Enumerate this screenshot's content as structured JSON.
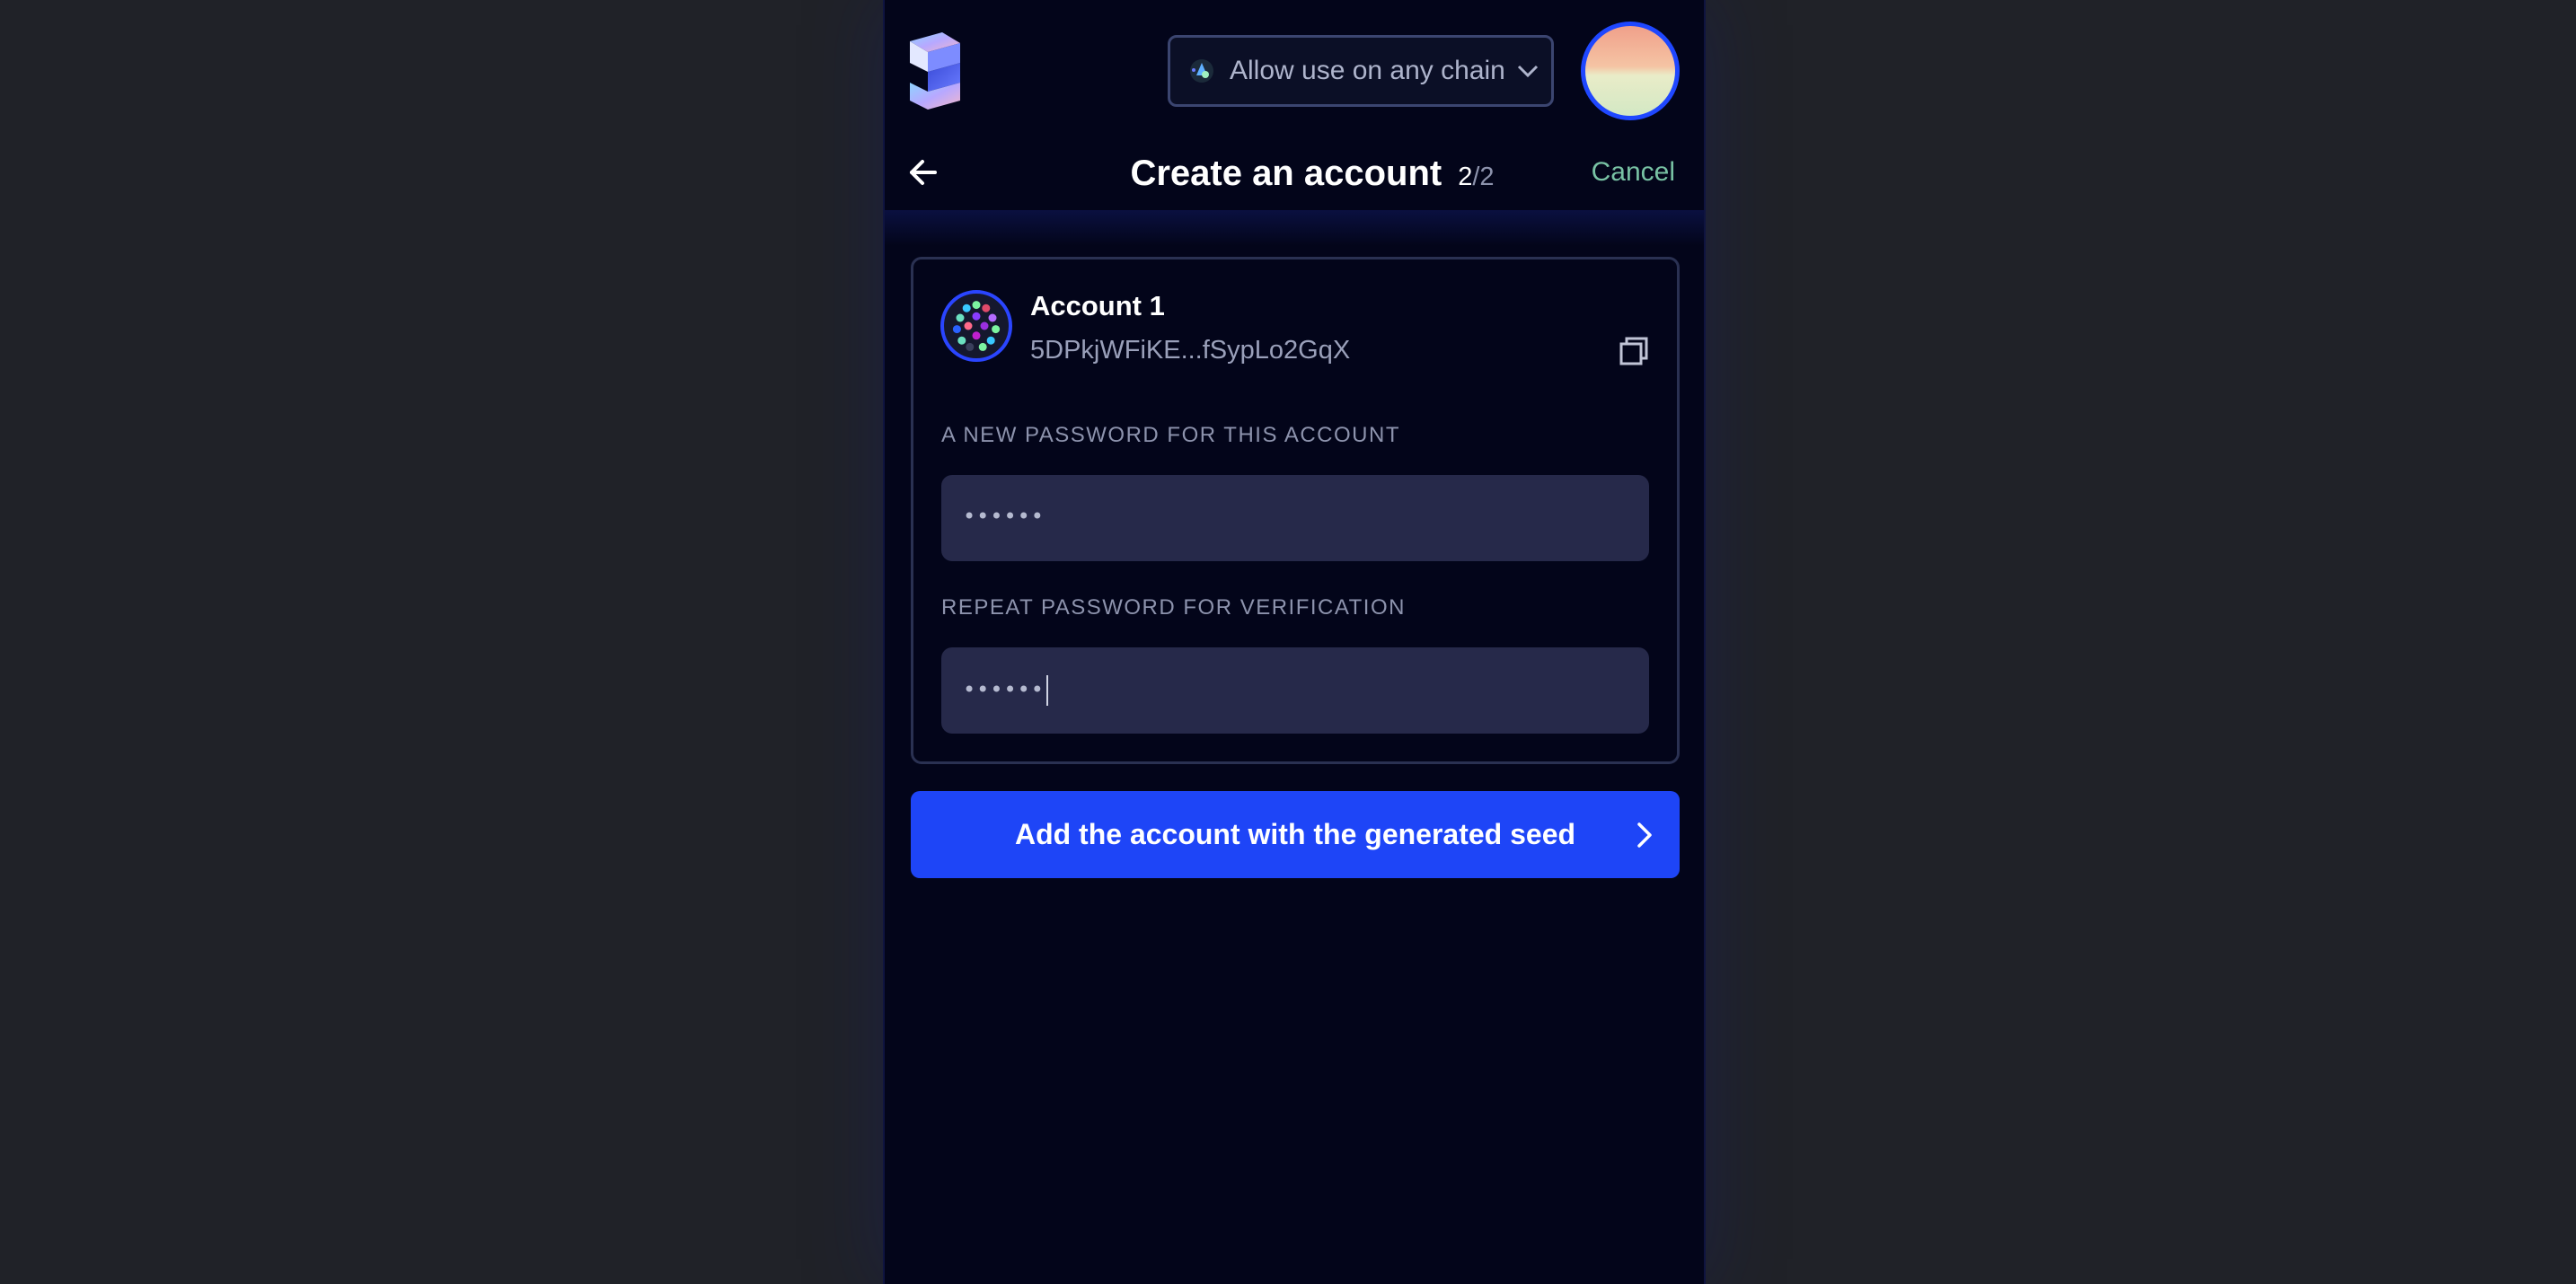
{
  "header": {
    "chain_select": {
      "label": "Allow use on any chain",
      "icon": "chain-icon"
    },
    "title": "Create an account",
    "step_current": "2",
    "step_total": "/2",
    "cancel_label": "Cancel"
  },
  "account": {
    "name": "Account 1",
    "address": "5DPkjWFiKE...fSypLo2GqX"
  },
  "form": {
    "new_password_label": "A NEW PASSWORD FOR THIS ACCOUNT",
    "new_password_value": "••••••",
    "repeat_password_label": "REPEAT PASSWORD FOR VERIFICATION",
    "repeat_password_value": "••••••"
  },
  "submit_label": "Add the account with the generated seed",
  "colors": {
    "page_bg": "#202228",
    "panel_bg": "#03051a",
    "accent": "#1e45f7",
    "cancel": "#78c2a4",
    "input_bg": "#26294a"
  }
}
